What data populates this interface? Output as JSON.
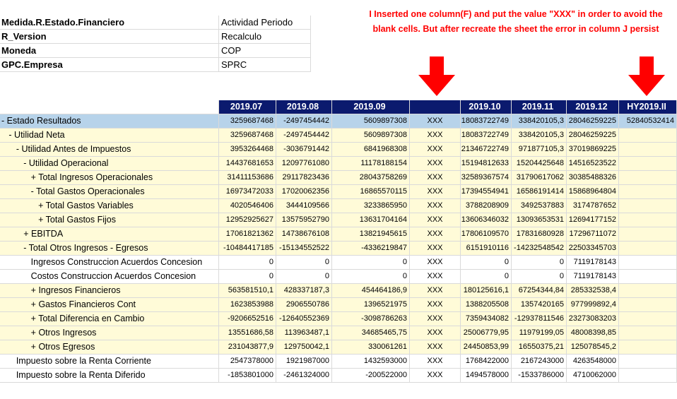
{
  "meta": [
    {
      "label": "Medida.R.Estado.Financiero",
      "value": "Actividad Periodo"
    },
    {
      "label": "R_Version",
      "value": "Recalculo"
    },
    {
      "label": "Moneda",
      "value": "COP"
    },
    {
      "label": "GPC.Empresa",
      "value": "SPRC"
    }
  ],
  "annotation": "I Inserted one column(F) and put the value \"XXX\" in order to avoid the blank cells. But after recreate the sheet the error in column J persist",
  "headers": [
    "2019.07",
    "2019.08",
    "2019.09",
    "",
    "2019.10",
    "2019.11",
    "2019.12",
    "HY2019.II"
  ],
  "rows": [
    {
      "label": "- Estado Resultados",
      "cells": [
        "3259687468",
        "-2497454442",
        "5609897308",
        "XXX",
        "18083722749",
        "338420105,3",
        "28046259225",
        "52840532414"
      ]
    },
    {
      "label": "   - Utilidad Neta",
      "cells": [
        "3259687468",
        "-2497454442",
        "5609897308",
        "XXX",
        "18083722749",
        "338420105,3",
        "28046259225",
        ""
      ]
    },
    {
      "label": "      - Utilidad Antes de Impuestos",
      "cells": [
        "3953264468",
        "-3036791442",
        "6841968308",
        "XXX",
        "21346722749",
        "971877105,3",
        "37019869225",
        ""
      ]
    },
    {
      "label": "         - Utilidad Operacional",
      "cells": [
        "14437681653",
        "12097761080",
        "11178188154",
        "XXX",
        "15194812633",
        "15204425648",
        "14516523522",
        ""
      ]
    },
    {
      "label": "            + Total Ingresos Operacionales",
      "cells": [
        "31411153686",
        "29117823436",
        "28043758269",
        "XXX",
        "32589367574",
        "31790617062",
        "30385488326",
        ""
      ]
    },
    {
      "label": "            - Total Gastos Operacionales",
      "cells": [
        "16973472033",
        "17020062356",
        "16865570115",
        "XXX",
        "17394554941",
        "16586191414",
        "15868964804",
        ""
      ]
    },
    {
      "label": "               + Total Gastos Variables",
      "cells": [
        "4020546406",
        "3444109566",
        "3233865950",
        "XXX",
        "3788208909",
        "3492537883",
        "3174787652",
        ""
      ]
    },
    {
      "label": "               + Total Gastos Fijos",
      "cells": [
        "12952925627",
        "13575952790",
        "13631704164",
        "XXX",
        "13606346032",
        "13093653531",
        "12694177152",
        ""
      ]
    },
    {
      "label": "         + EBITDA",
      "cells": [
        "17061821362",
        "14738676108",
        "13821945615",
        "XXX",
        "17806109570",
        "17831680928",
        "17296711072",
        ""
      ]
    },
    {
      "label": "         - Total Otros Ingresos - Egresos",
      "cells": [
        "-10484417185",
        "-15134552522",
        "-4336219847",
        "XXX",
        "6151910116",
        "-14232548542",
        "22503345703",
        ""
      ]
    },
    {
      "label": "            Ingresos Construccion Acuerdos Concesion",
      "cells": [
        "0",
        "0",
        "0",
        "XXX",
        "0",
        "0",
        "7119178143",
        ""
      ]
    },
    {
      "label": "            Costos Construccion Acuerdos Concesion",
      "cells": [
        "0",
        "0",
        "0",
        "XXX",
        "0",
        "0",
        "7119178143",
        ""
      ]
    },
    {
      "label": "            + Ingresos Financieros",
      "cells": [
        "563581510,1",
        "428337187,3",
        "454464186,9",
        "XXX",
        "180125616,1",
        "67254344,84",
        "285332538,4",
        ""
      ]
    },
    {
      "label": "            + Gastos Financieros Cont",
      "cells": [
        "1623853988",
        "2906550786",
        "1396521975",
        "XXX",
        "1388205508",
        "1357420165",
        "977999892,4",
        ""
      ]
    },
    {
      "label": "            + Total Diferencia en Cambio",
      "cells": [
        "-9206652516",
        "-12640552369",
        "-3098786263",
        "XXX",
        "7359434082",
        "-12937811546",
        "23273083203",
        ""
      ]
    },
    {
      "label": "            + Otros Ingresos",
      "cells": [
        "13551686,58",
        "113963487,1",
        "34685465,75",
        "XXX",
        "25006779,95",
        "11979199,05",
        "48008398,85",
        ""
      ]
    },
    {
      "label": "            + Otros Egresos",
      "cells": [
        "231043877,9",
        "129750042,1",
        "330061261",
        "XXX",
        "24450853,99",
        "16550375,21",
        "125078545,2",
        ""
      ]
    },
    {
      "label": "      Impuesto sobre la Renta Corriente",
      "cells": [
        "2547378000",
        "1921987000",
        "1432593000",
        "XXX",
        "1768422000",
        "2167243000",
        "4263548000",
        ""
      ]
    },
    {
      "label": "      Impuesto sobre la Renta Diferido",
      "cells": [
        "-1853801000",
        "-2461324000",
        "-200522000",
        "XXX",
        "1494578000",
        "-1533786000",
        "4710062000",
        ""
      ]
    }
  ],
  "colors": {
    "header_bg": "#0b1a6e",
    "top_row_bg": "#b7d3ea",
    "highlight_bg": "#fffbd8",
    "annotation": "#ff0000"
  }
}
